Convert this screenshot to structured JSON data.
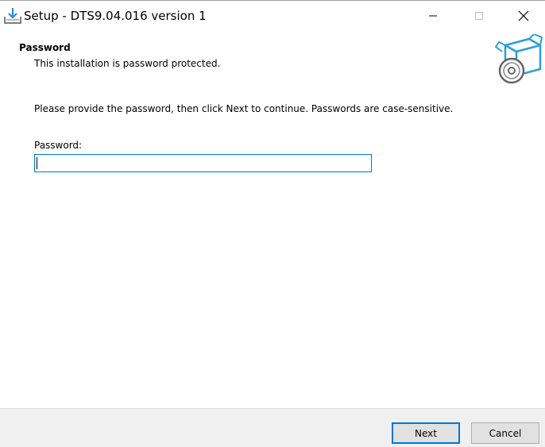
{
  "window": {
    "title": "Setup - DTS9.04.016 version 1",
    "app_icon": "install-download-icon",
    "controls": {
      "minimize_icon": "minimize-icon",
      "maximize_icon": "maximize-icon",
      "close_icon": "close-icon"
    }
  },
  "header": {
    "title": "Password",
    "subtitle": "This installation is password protected.",
    "image_icon": "software-box-disc-icon"
  },
  "body": {
    "instructions": "Please provide the password, then click Next to continue. Passwords are case-sensitive.",
    "password_label": "Password:",
    "password_value": ""
  },
  "footer": {
    "next_label": "Next",
    "cancel_label": "Cancel"
  },
  "colors": {
    "accent": "#0078d7",
    "footer_bg": "#f0f0f0",
    "button_bg": "#e1e1e1"
  }
}
